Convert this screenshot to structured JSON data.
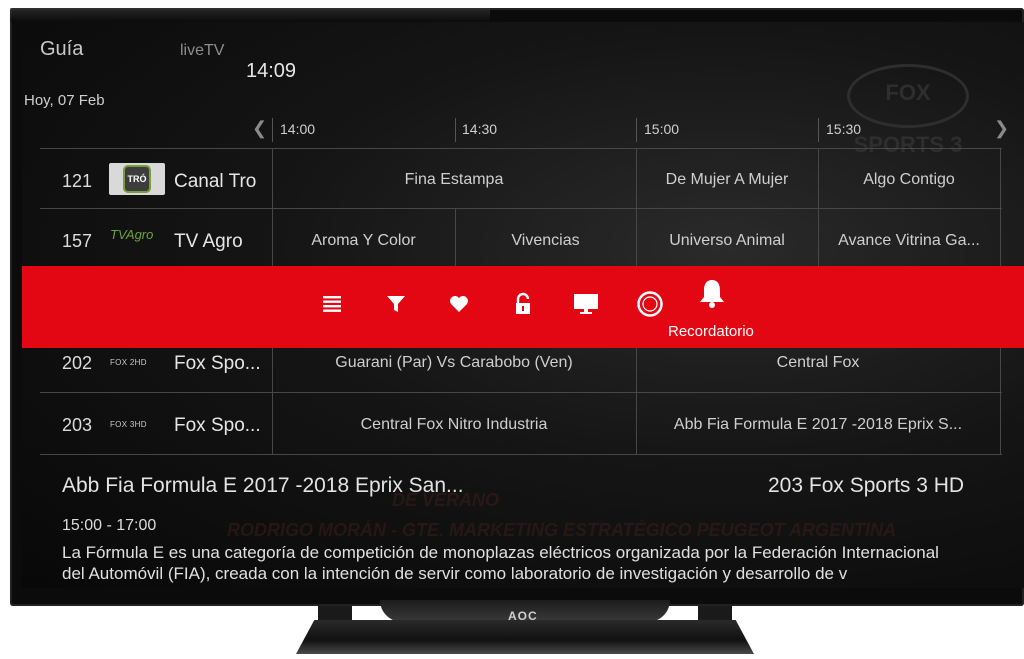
{
  "header": {
    "title": "Guía",
    "subtitle": "liveTV",
    "clock": "14:09",
    "date": "Hoy, 07 Feb",
    "times": [
      "14:00",
      "14:30",
      "15:00",
      "15:30"
    ]
  },
  "background": {
    "logo": "FOX SPORTS 3",
    "line1": "DE VERANO",
    "line2": "RODRIGO MORÁN - GTE. MARKETING ESTRATÉGICO PEUGEOT ARGENTINA"
  },
  "channels": [
    {
      "number": "121",
      "name": "Canal Tro",
      "logo_text": "TRÓ",
      "programs": [
        "Fina Estampa",
        "De Mujer A Mujer",
        "Algo Contigo"
      ]
    },
    {
      "number": "157",
      "name": "TV Agro",
      "logo_text": "TVAgro",
      "programs": [
        "Aroma Y Color",
        "Vivencias",
        "Universo Animal",
        "Avance Vitrina Ga..."
      ]
    },
    {
      "number": "202",
      "name": "Fox Spo...",
      "logo_text": "FOX 2HD",
      "programs": [
        "Guarani (Par) Vs Carabobo (Ven)",
        "Central Fox"
      ]
    },
    {
      "number": "203",
      "name": "Fox Spo...",
      "logo_text": "FOX 3HD",
      "programs": [
        "Central Fox Nitro Industria",
        "Abb Fia Formula E 2017 -2018 Eprix S..."
      ]
    }
  ],
  "action_bar": {
    "color": "#e30613",
    "icons": [
      "list-icon",
      "filter-icon",
      "heart-icon",
      "lock-icon",
      "monitor-icon",
      "record-icon",
      "bell-icon"
    ],
    "active_label": "Recordatorio"
  },
  "info": {
    "title": "Abb Fia Formula E 2017 -2018 Eprix San...",
    "channel": "203 Fox Sports 3 HD",
    "time": "15:00 - 17:00",
    "description_line1": "La Fórmula E es una categoría de competición de monoplazas eléctricos organizada por la Federación Internacional",
    "description_line2": "del Automóvil (FIA), creada con la intención de servir como laboratorio de investigación y desarrollo de v"
  },
  "tv": {
    "brand": "AOC"
  }
}
